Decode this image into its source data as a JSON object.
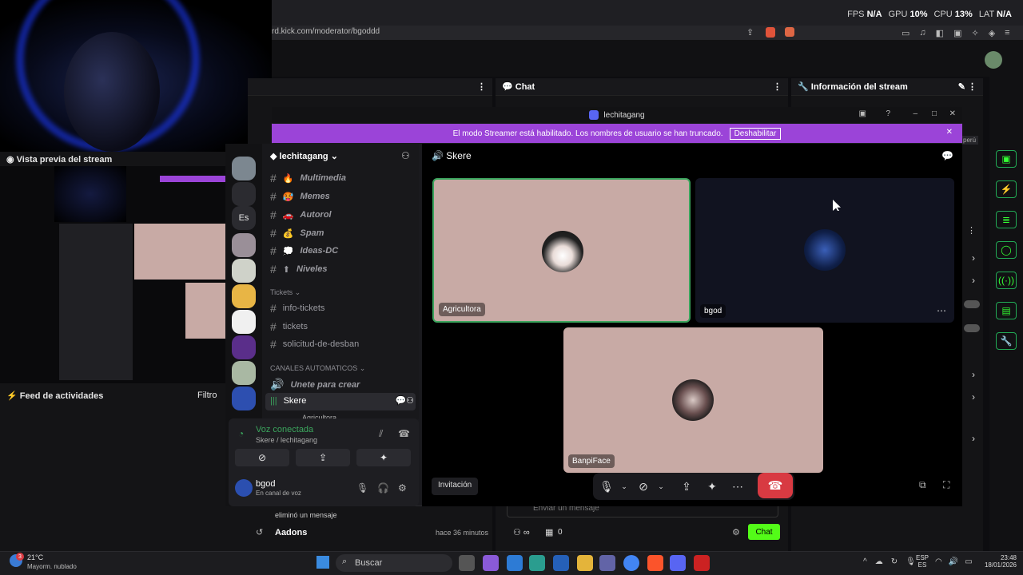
{
  "browser": {
    "url": "rd.kick.com/moderator/bgoddd",
    "perf": {
      "fps_label": "FPS",
      "fps": "N/A",
      "gpu_label": "GPU",
      "gpu": "10%",
      "cpu_label": "CPU",
      "cpu": "13%",
      "lat_label": "LAT",
      "lat": "N/A"
    }
  },
  "left": {
    "preview_title": "Vista previa del stream",
    "feed_title": "Feed de actividades",
    "filter": "Filtro"
  },
  "kick": {
    "panel2_title": "Chat",
    "panel3_title": "Información del stream",
    "peru": "perú",
    "event1_sub": "eliminó un mensaje",
    "event2_user": "Aadons",
    "event2_time": "hace 36 minutos",
    "chat_placeholder": "Enviar un mensaje",
    "chat_count": "0",
    "chat_button": "Chat"
  },
  "discord": {
    "window_title": "lechitagang",
    "streamer_text": "El modo Streamer está habilitado. Los nombres de usuario se han truncado.",
    "streamer_button": "Deshabilitar",
    "server_name": "lechitagang",
    "guild_text": "Es",
    "channels": [
      {
        "emoji": "🔥",
        "name": "Multimedia"
      },
      {
        "emoji": "🥵",
        "name": "Memes"
      },
      {
        "emoji": "🚗",
        "name": "Autorol"
      },
      {
        "emoji": "💰",
        "name": "Spam"
      },
      {
        "emoji": "💭",
        "name": "Ideas-DC"
      },
      {
        "emoji": "⬆",
        "name": "Niveles"
      }
    ],
    "tickets_category": "Tickets",
    "tickets_channels": [
      "info-tickets",
      "tickets",
      "solicitud-de-desban"
    ],
    "auto_category": "CANALES AUTOMATICOS",
    "auto_join": "Unete para crear",
    "voice_channel": "Skere",
    "voice_sub": "Agricultora",
    "voice_connected": "Voz conectada",
    "voice_path": "Skere / lechitagang",
    "user_name": "bgod",
    "user_status": "En canal de voz",
    "main_channel": "Skere",
    "participants": [
      "Agricultora",
      "bgod",
      "BanpiFace"
    ],
    "invite": "Invitación"
  },
  "taskbar": {
    "weather_temp": "21°C",
    "weather_desc": "Mayorm. nublado",
    "search": "Buscar",
    "lang1": "ESP",
    "lang2": "ES",
    "time": "23:48",
    "date": "18/01/2026",
    "notif_badge": "3"
  },
  "colors": {
    "kick_green": "#53fc18",
    "streamer_purple": "#9b44d8",
    "hangup_red": "#d83a42",
    "tile_pink": "#c8aaa5"
  }
}
